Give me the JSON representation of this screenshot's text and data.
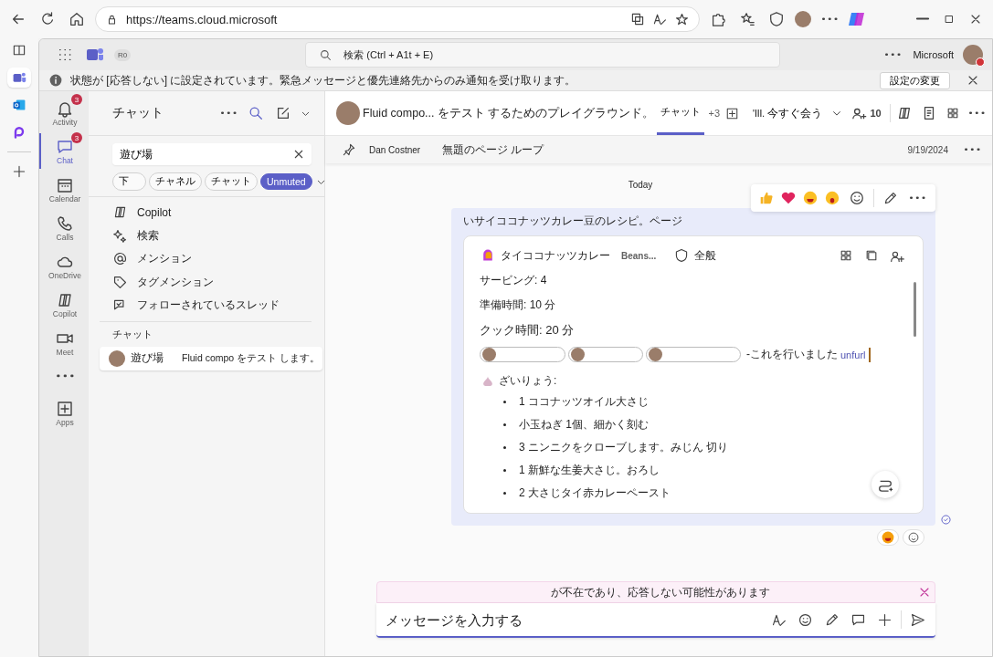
{
  "browser": {
    "url": "https://teams.cloud.microsoft"
  },
  "teams_bar": {
    "tenant_badge": "R0",
    "search_placeholder": "検索 (Ctrl + A1t + E)",
    "org": "Microsoft"
  },
  "notice": {
    "text": "状態が [応答しない] に設定されています。緊急メッセージと優先連絡先からのみ通知を受け取ります。",
    "button": "設定の変更"
  },
  "rail": [
    {
      "kind": "activity",
      "label": "Activity",
      "badge": "3",
      "selected": false
    },
    {
      "kind": "chat",
      "label": "Chat",
      "badge": "3",
      "selected": true
    },
    {
      "kind": "calendar",
      "label": "Calendar",
      "selected": false
    },
    {
      "kind": "calls",
      "label": "Calls",
      "selected": false
    },
    {
      "kind": "onedrive",
      "label": "OneDrive",
      "selected": false
    },
    {
      "kind": "copilot",
      "label": "Copilot",
      "selected": false
    },
    {
      "kind": "meet",
      "label": "Meet",
      "selected": false
    },
    {
      "kind": "more",
      "selected": false
    },
    {
      "kind": "apps",
      "label": "Apps",
      "selected": false
    }
  ],
  "chat_pane": {
    "title": "チャット",
    "search_value": "遊び場",
    "filters": [
      {
        "label": "下",
        "selected": false
      },
      {
        "label": "チャネル",
        "selected": false
      },
      {
        "label": "チャット",
        "selected": false
      },
      {
        "label": "Unmuted",
        "selected": true
      }
    ],
    "quick_items": [
      {
        "kind": "copilot",
        "label": "Copilot"
      },
      {
        "kind": "discover",
        "label": "検索"
      },
      {
        "kind": "mentions",
        "label": "メンション"
      },
      {
        "kind": "tags",
        "label": "タグメンション"
      },
      {
        "kind": "threads",
        "label": "フォローされているスレッド"
      }
    ],
    "section": "チャット",
    "chats": [
      {
        "name": "遊び場",
        "preview": "Fluid compo をテスト します。",
        "selected": true
      }
    ]
  },
  "conversation": {
    "title": "Fluid compo... をテスト するためのプレイグラウンド。",
    "tabs": [
      {
        "label": "チャット",
        "selected": true
      }
    ],
    "more_tabs": "+3",
    "meet_prefix": "'III.",
    "meet": "今すぐ会う",
    "participants": "10",
    "pinned": {
      "author": "Dan Costner",
      "title": "無題のページ ループ",
      "date": "9/19/2024"
    },
    "date_divider": "Today",
    "message": {
      "text": "いサイココナッツカレー豆のレシピ。ページ",
      "card": {
        "title": "タイココナッツカレー",
        "subtitle": "Beans...",
        "label": "全般",
        "fields": [
          "サービング: 4",
          "準備時間: 10 分",
          "クック時間: 20 分"
        ],
        "mention_suffix": "-これを行いました",
        "link": "unfurl",
        "heading": "ざいりょう:",
        "items": [
          "1 ココナッツオイル大さじ",
          "小玉ねぎ 1個、細かく刻む",
          "3 ニンニクをクローブします。みじん 切り",
          "1 新鮮な生姜大さじ。おろし",
          "2 大さじタイ赤カレーペースト"
        ]
      }
    },
    "banner": "が不在であり、応答しない可能性があります",
    "composer": {
      "placeholder": "メッセージを入力する"
    }
  }
}
